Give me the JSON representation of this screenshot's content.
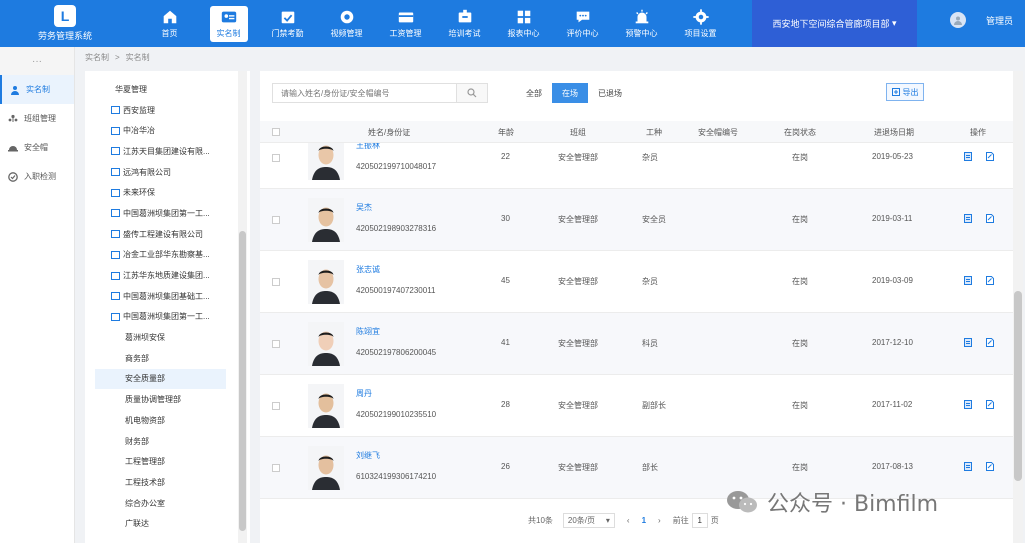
{
  "app": {
    "title": "劳务管理系统",
    "logo_letter": "L"
  },
  "nav": [
    {
      "label": "首页",
      "icon": "home-icon",
      "active": false
    },
    {
      "label": "实名制",
      "icon": "id-card-icon",
      "active": true
    },
    {
      "label": "门禁考勤",
      "icon": "calendar-check-icon",
      "active": false
    },
    {
      "label": "视频管理",
      "icon": "video-icon",
      "active": false
    },
    {
      "label": "工资管理",
      "icon": "wallet-icon",
      "active": false
    },
    {
      "label": "培训考试",
      "icon": "training-icon",
      "active": false
    },
    {
      "label": "报表中心",
      "icon": "report-icon",
      "active": false
    },
    {
      "label": "评价中心",
      "icon": "chat-icon",
      "active": false
    },
    {
      "label": "预警中心",
      "icon": "alarm-icon",
      "active": false
    },
    {
      "label": "项目设置",
      "icon": "gear-icon",
      "active": false
    }
  ],
  "project_select": "西安地下空间综合管廊项目部",
  "user": {
    "name": "管理员"
  },
  "left_menu": {
    "collapse": "···",
    "items": [
      {
        "label": "实名制",
        "icon": "person-icon",
        "active": true
      },
      {
        "label": "班组管理",
        "icon": "team-icon",
        "active": false
      },
      {
        "label": "安全帽",
        "icon": "helmet-icon",
        "active": false
      },
      {
        "label": "入职检测",
        "icon": "check-icon",
        "active": false
      }
    ]
  },
  "breadcrumb": [
    "实名制",
    "实名制"
  ],
  "tree": {
    "root": "华夏管理",
    "orgs": [
      "西安监理",
      "中冶华冶",
      "江苏天目集团建设有限...",
      "远鸿有限公司",
      "未来环保",
      "中国葛洲坝集团第一工...",
      "盛传工程建设有限公司",
      "冶金工业部华东勘察基...",
      "江苏华东地质建设集团...",
      "中国葛洲坝集团基础工...",
      "中国葛洲坝集团第一工..."
    ],
    "subs": [
      "葛洲坝安保",
      "商务部",
      "安全质量部",
      "质量协调管理部",
      "机电物资部",
      "财务部",
      "工程管理部",
      "工程技术部",
      "综合办公室",
      "广联达"
    ],
    "selected_sub": "安全质量部"
  },
  "search": {
    "placeholder": "请输入姓名/身份证/安全帽编号"
  },
  "filters": [
    {
      "label": "全部",
      "active": false
    },
    {
      "label": "在场",
      "active": true
    },
    {
      "label": "已退场",
      "active": false
    }
  ],
  "export_label": "导出",
  "table": {
    "headers": {
      "name_id": "姓名/身份证",
      "age": "年龄",
      "team": "班组",
      "trade": "工种",
      "helmet": "安全帽编号",
      "status": "在岗状态",
      "entry_date": "进退场日期",
      "ops": "操作"
    },
    "rows": [
      {
        "name": "王振林",
        "id": "420502199710048017",
        "age": "22",
        "team": "安全管理部",
        "trade": "杂员",
        "helmet": "",
        "status": "在岗",
        "date": "2019-05-23"
      },
      {
        "name": "吴杰",
        "id": "420502198903278316",
        "age": "30",
        "team": "安全管理部",
        "trade": "安全员",
        "helmet": "",
        "status": "在岗",
        "date": "2019-03-11"
      },
      {
        "name": "张志诚",
        "id": "420500197407230011",
        "age": "45",
        "team": "安全管理部",
        "trade": "杂员",
        "helmet": "",
        "status": "在岗",
        "date": "2019-03-09"
      },
      {
        "name": "陈翊宜",
        "id": "420502197806200045",
        "age": "41",
        "team": "安全管理部",
        "trade": "科员",
        "helmet": "",
        "status": "在岗",
        "date": "2017-12-10"
      },
      {
        "name": "周丹",
        "id": "420502199010235510",
        "age": "28",
        "team": "安全管理部",
        "trade": "副部长",
        "helmet": "",
        "status": "在岗",
        "date": "2017-11-02"
      },
      {
        "name": "刘继飞",
        "id": "610324199306174210",
        "age": "26",
        "team": "安全管理部",
        "trade": "部长",
        "helmet": "",
        "status": "在岗",
        "date": "2017-08-13"
      }
    ]
  },
  "pager": {
    "total": "共10条",
    "page_size": "20条/页",
    "prev": "‹",
    "current": "1",
    "next": "›",
    "goto_label": "前往",
    "goto_value": "1",
    "goto_suffix": "页"
  },
  "watermark": "公众号 · Bimfilm",
  "colors": {
    "primary": "#1e7be0",
    "project_bg": "#2e5fd6",
    "active_filter": "#3a8ee6"
  }
}
